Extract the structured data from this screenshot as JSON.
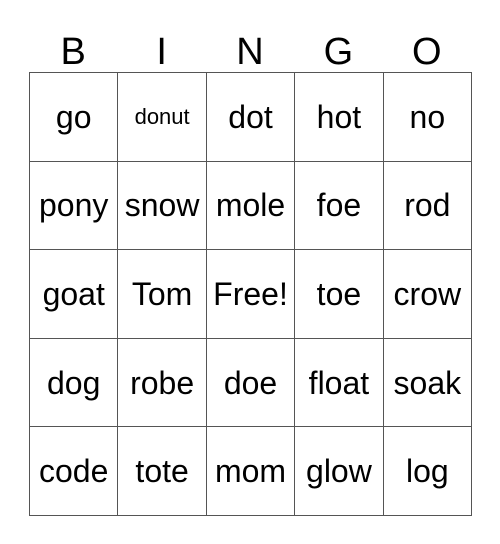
{
  "card": {
    "headers": [
      "B",
      "I",
      "N",
      "G",
      "O"
    ],
    "rows": [
      [
        {
          "text": "go",
          "size": "normal",
          "free": false
        },
        {
          "text": "donut",
          "size": "small",
          "free": false
        },
        {
          "text": "dot",
          "size": "normal",
          "free": false
        },
        {
          "text": "hot",
          "size": "normal",
          "free": false
        },
        {
          "text": "no",
          "size": "normal",
          "free": false
        }
      ],
      [
        {
          "text": "pony",
          "size": "normal",
          "free": false
        },
        {
          "text": "snow",
          "size": "normal",
          "free": false
        },
        {
          "text": "mole",
          "size": "normal",
          "free": false
        },
        {
          "text": "foe",
          "size": "normal",
          "free": false
        },
        {
          "text": "rod",
          "size": "normal",
          "free": false
        }
      ],
      [
        {
          "text": "goat",
          "size": "normal",
          "free": false
        },
        {
          "text": "Tom",
          "size": "normal",
          "free": false
        },
        {
          "text": "Free!",
          "size": "normal",
          "free": true
        },
        {
          "text": "toe",
          "size": "normal",
          "free": false
        },
        {
          "text": "crow",
          "size": "normal",
          "free": false
        }
      ],
      [
        {
          "text": "dog",
          "size": "normal",
          "free": false
        },
        {
          "text": "robe",
          "size": "normal",
          "free": false
        },
        {
          "text": "doe",
          "size": "normal",
          "free": false
        },
        {
          "text": "float",
          "size": "normal",
          "free": false
        },
        {
          "text": "soak",
          "size": "normal",
          "free": false
        }
      ],
      [
        {
          "text": "code",
          "size": "normal",
          "free": false
        },
        {
          "text": "tote",
          "size": "normal",
          "free": false
        },
        {
          "text": "mom",
          "size": "normal",
          "free": false
        },
        {
          "text": "glow",
          "size": "normal",
          "free": false
        },
        {
          "text": "log",
          "size": "normal",
          "free": false
        }
      ]
    ],
    "colors": {
      "grid_line": "#555555",
      "cell_background": "#ffffff",
      "text": "#000000",
      "page_background": "#ffffff"
    }
  }
}
